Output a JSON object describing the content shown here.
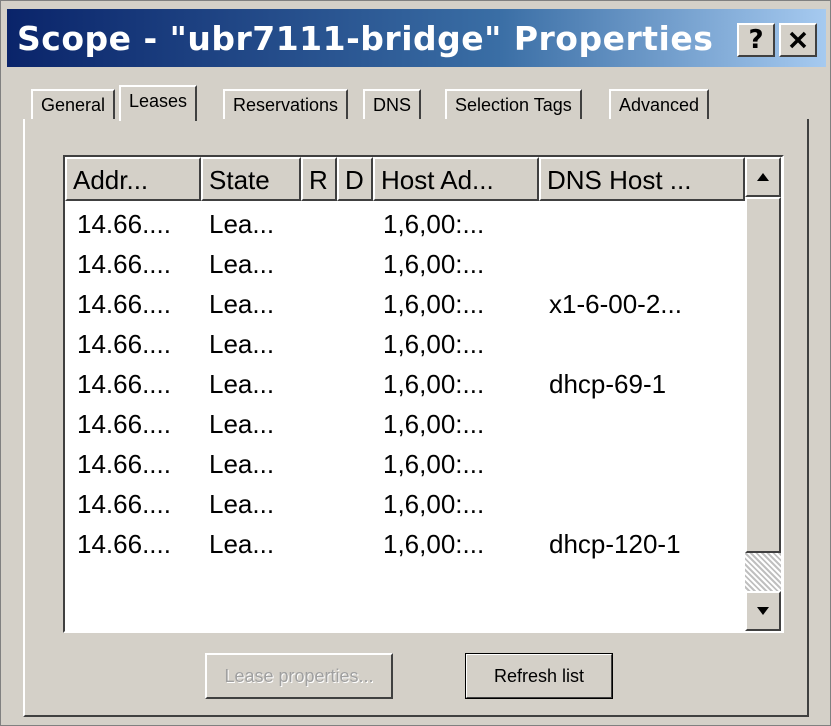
{
  "window": {
    "title": "Scope - \"ubr7111-bridge\" Properties",
    "help_label": "?",
    "close_label": "✕"
  },
  "tabs": [
    {
      "label": "General",
      "active": false
    },
    {
      "label": "Leases",
      "active": true
    },
    {
      "label": "Reservations",
      "active": false
    },
    {
      "label": "DNS",
      "active": false
    },
    {
      "label": "Selection Tags",
      "active": false
    },
    {
      "label": "Advanced",
      "active": false
    }
  ],
  "table": {
    "columns": [
      "Addr...",
      "State",
      "R",
      "D",
      "Host Ad...",
      "DNS Host ..."
    ],
    "rows": [
      [
        "14.66....",
        "Lea...",
        "",
        "",
        "1,6,00:...",
        ""
      ],
      [
        "14.66....",
        "Lea...",
        "",
        "",
        "1,6,00:...",
        ""
      ],
      [
        "14.66....",
        "Lea...",
        "",
        "",
        "1,6,00:...",
        "x1-6-00-2..."
      ],
      [
        "14.66....",
        "Lea...",
        "",
        "",
        "1,6,00:...",
        ""
      ],
      [
        "14.66....",
        "Lea...",
        "",
        "",
        "1,6,00:...",
        "dhcp-69-1"
      ],
      [
        "14.66....",
        "Lea...",
        "",
        "",
        "1,6,00:...",
        ""
      ],
      [
        "14.66....",
        "Lea...",
        "",
        "",
        "1,6,00:...",
        ""
      ],
      [
        "14.66....",
        "Lea...",
        "",
        "",
        "1,6,00:...",
        ""
      ],
      [
        "14.66....",
        "Lea...",
        "",
        "",
        "1,6,00:...",
        "dhcp-120-1"
      ]
    ]
  },
  "scrollbar": {
    "up_icon": "arrow-up-icon",
    "down_icon": "arrow-down-icon"
  },
  "buttons": {
    "lease_properties": "Lease properties...",
    "refresh_list": "Refresh list"
  }
}
